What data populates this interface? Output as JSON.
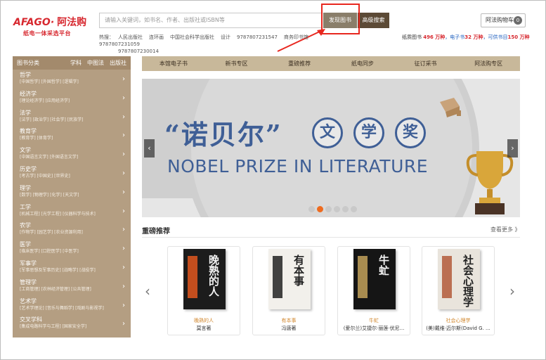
{
  "logo": {
    "brand": "AFAGO",
    "name": "阿法购",
    "tagline": "纸电一体采选平台"
  },
  "search": {
    "placeholder": "请输入关键词，如书名、作者、出版社或ISBN等",
    "discover_label": "发现图书",
    "advanced_label": "高级搜索"
  },
  "cart": {
    "label": "阿法购物车",
    "count": "0"
  },
  "hot": {
    "label": "热搜：",
    "terms": [
      "人民出版社",
      "连环画",
      "中国社会科学出版社",
      "设计",
      "9787807231547",
      "商务印书馆",
      "9787807231059",
      "9787807230014"
    ]
  },
  "stats": {
    "paper_label": "纸质图书",
    "paper_value": "496 万种",
    "ebook_label": "电子书",
    "ebook_value": "32 万种",
    "supply_label": "可供书目",
    "supply_value": "150 万种"
  },
  "sidebar": {
    "title": "图书分类",
    "tabs": [
      "学科",
      "中图法",
      "出版社"
    ],
    "categories": [
      {
        "name": "哲学",
        "subs": "[中国哲学] [外国哲学] [逻辑学]"
      },
      {
        "name": "经济学",
        "subs": "[理论经济学] [应用经济学]"
      },
      {
        "name": "法学",
        "subs": "[法学] [政治学] [社会学] [民族学]"
      },
      {
        "name": "教育学",
        "subs": "[教育学] [体育学]"
      },
      {
        "name": "文学",
        "subs": "[中国语言文学] [外国语言文学]"
      },
      {
        "name": "历史学",
        "subs": "[考古学] [中国史] [世界史]"
      },
      {
        "name": "理学",
        "subs": "[数学] [物理学] [化学] [天文学]"
      },
      {
        "name": "工学",
        "subs": "[机械工程] [光学工程] [仪器科学与技术]"
      },
      {
        "name": "农学",
        "subs": "[作物学] [园艺学] [农业资源利用]"
      },
      {
        "name": "医学",
        "subs": "[临床医学] [口腔医学] [中医学]"
      },
      {
        "name": "军事学",
        "subs": "[军事思想及军事历史] [战略学] [战役学]"
      },
      {
        "name": "管理学",
        "subs": "[工商管理] [农林经济管理] [公共管理]"
      },
      {
        "name": "艺术学",
        "subs": "[艺术学理论] [音乐与舞蹈学] [戏剧与影视学]"
      },
      {
        "name": "交叉学科",
        "subs": "[集成电路科学与工程] [国家安全学]"
      }
    ]
  },
  "nav": [
    "本馆电子书",
    "新书专区",
    "重磅推荐",
    "纸电同步",
    "征订采书",
    "阿法购专区"
  ],
  "banner": {
    "title": "“诺贝尔”",
    "chars": [
      "文",
      "学",
      "奖"
    ],
    "subtitle": "NOBEL PRIZE IN LITERATURE",
    "dots": 6,
    "active_dot": 1
  },
  "recommend": {
    "title": "重磅推荐",
    "more": "查看更多 》",
    "books": [
      {
        "title": "晚熟的人",
        "author": "莫言著",
        "cover_color": "#1c1c1c",
        "accent": "#e0571f",
        "cover_text": "晚熟的人"
      },
      {
        "title": "有本事",
        "author": "冯唐著",
        "cover_color": "#f2f0eb",
        "accent": "#222222",
        "cover_text": "有本事"
      },
      {
        "title": "牛虻",
        "author": "(爱尔兰)艾捷尔·丽莲·伏尼...",
        "cover_color": "#151515",
        "accent": "#c2a15a",
        "cover_text": "牛虻"
      },
      {
        "title": "社会心理学",
        "author": "(美)戴维·迈尔斯(David G. ...",
        "cover_color": "#e9e4dc",
        "accent": "#b35a3a",
        "cover_text": "社会心理学"
      }
    ]
  }
}
